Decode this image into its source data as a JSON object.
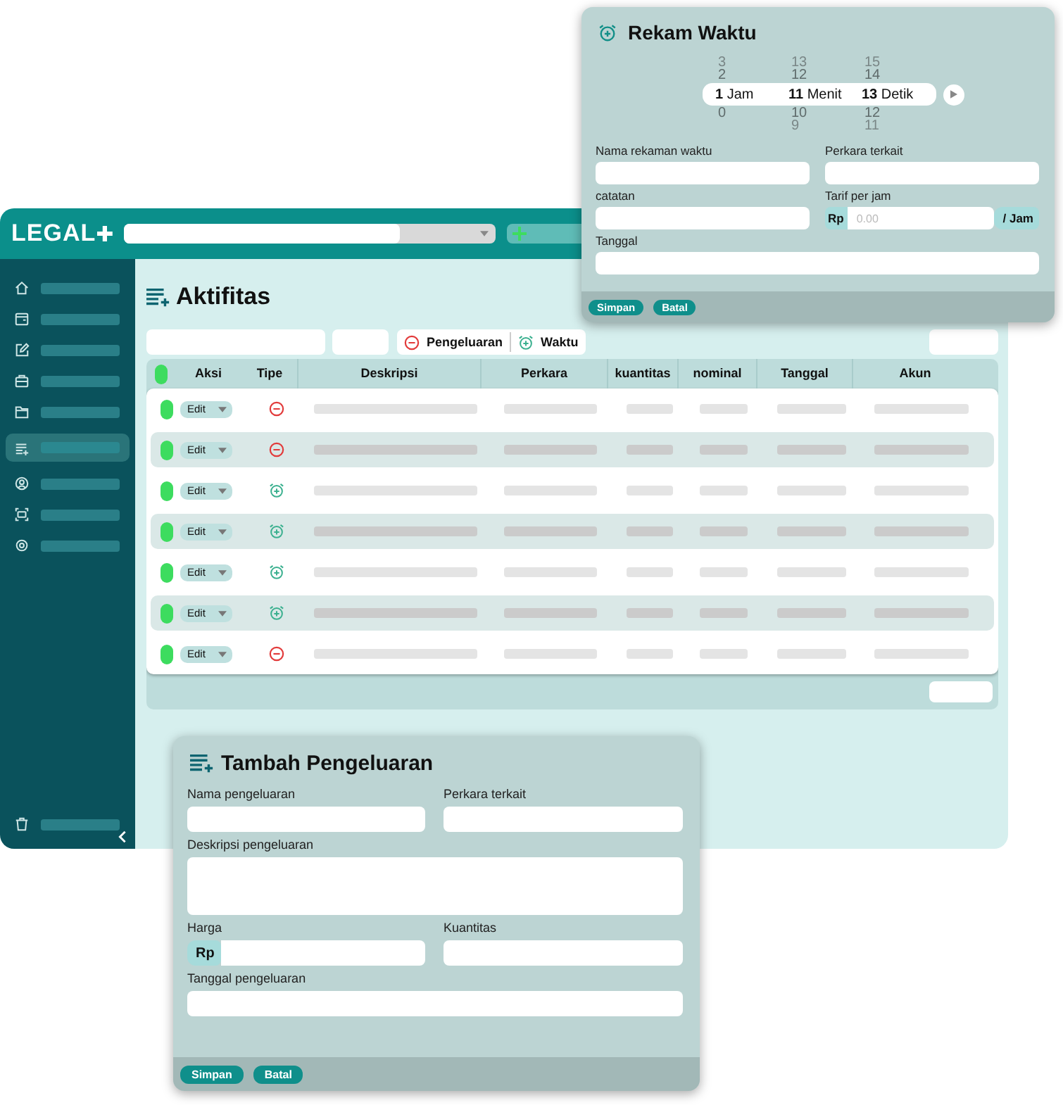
{
  "app": {
    "logo": "LEGAL",
    "sidebar": {
      "items": [
        {
          "kind": "home",
          "selected": false
        },
        {
          "kind": "calendar",
          "selected": false
        },
        {
          "kind": "edit",
          "selected": false
        },
        {
          "kind": "briefcase",
          "selected": false
        },
        {
          "kind": "folder",
          "selected": false
        },
        {
          "kind": "list",
          "selected": true
        },
        {
          "kind": "user",
          "selected": false
        },
        {
          "kind": "scan",
          "selected": false
        },
        {
          "kind": "gear",
          "selected": false
        }
      ],
      "footer_item": {
        "kind": "trash",
        "selected": false
      }
    },
    "page": {
      "title": "Aktifitas",
      "filters": [
        {
          "kind": "expense",
          "label": "Pengeluaran"
        },
        {
          "kind": "time",
          "label": "Waktu"
        }
      ],
      "table": {
        "columns": [
          "Aksi",
          "Tipe",
          "Deskripsi",
          "Perkara",
          "kuantitas",
          "nominal",
          "Tanggal",
          "Akun"
        ],
        "rows": [
          {
            "kind": "expense",
            "action": "Edit"
          },
          {
            "kind": "expense",
            "action": "Edit"
          },
          {
            "kind": "time",
            "action": "Edit"
          },
          {
            "kind": "time",
            "action": "Edit"
          },
          {
            "kind": "time",
            "action": "Edit"
          },
          {
            "kind": "time",
            "action": "Edit"
          },
          {
            "kind": "expense",
            "action": "Edit"
          }
        ]
      }
    }
  },
  "time_dialog": {
    "title": "Rekam Waktu",
    "timer": [
      {
        "above": [
          "3",
          "2"
        ],
        "value": "1",
        "unit": "Jam",
        "below": [
          "0"
        ]
      },
      {
        "above": [
          "13",
          "12"
        ],
        "value": "11",
        "unit": "Menit",
        "below": [
          "10",
          "9"
        ]
      },
      {
        "above": [
          "15",
          "14"
        ],
        "value": "13",
        "unit": "Detik",
        "below": [
          "12",
          "11"
        ]
      }
    ],
    "fields": {
      "name": "Nama rekaman waktu",
      "case": "Perkara terkait",
      "notes": "catatan",
      "rate": {
        "label": "Tarif per jam",
        "prefix": "Rp",
        "placeholder": "0.00",
        "suffix": "/ Jam"
      },
      "date": "Tanggal"
    },
    "buttons": [
      "Simpan",
      "Batal"
    ]
  },
  "expense_dialog": {
    "title": "Tambah Pengeluaran",
    "fields": {
      "name": "Nama pengeluaran",
      "case": "Perkara terkait",
      "description": "Deskripsi pengeluaran",
      "price": {
        "label": "Harga",
        "prefix": "Rp"
      },
      "quantity": "Kuantitas",
      "date": "Tanggal pengeluaran"
    },
    "buttons": [
      "Simpan",
      "Batal"
    ]
  }
}
